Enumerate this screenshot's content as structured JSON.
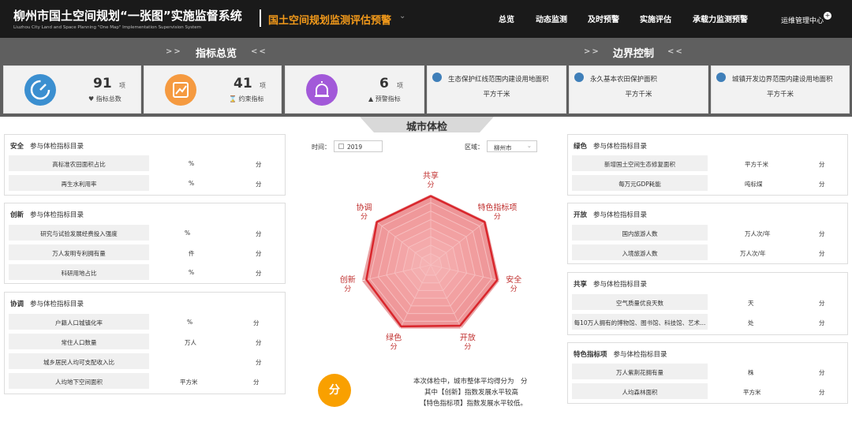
{
  "header": {
    "title": "柳州市国土空间规划“一张图”实施监督系统",
    "subtitle": "Liuzhou City Land and Space Planning \"One Map\" Implementation Supervision System",
    "module": "国土空间规划监测评估预警",
    "nav": [
      "总览",
      "动态监测",
      "及时预警",
      "实施评估",
      "承载力监测预警"
    ],
    "ops": "运维管理中心",
    "ops_badge": "+"
  },
  "band": {
    "left_title": "指标总览",
    "right_title": "边界控制",
    "chev_left": ">>",
    "chev_right": "<<"
  },
  "kpis": [
    {
      "value": "91",
      "unit": "项",
      "label": "指标总数",
      "label_icon": "heart-icon",
      "color": "#3b8fd0"
    },
    {
      "value": "41",
      "unit": "项",
      "label": "约束指标",
      "label_icon": "hourglass-icon",
      "color": "#f59a40"
    },
    {
      "value": "6",
      "unit": "项",
      "label": "预警指标",
      "label_icon": "warning-icon",
      "color": "#a259d9"
    }
  ],
  "boundaries": [
    {
      "title": "生态保护红线范围内建设用地面积",
      "unit": "平方千米",
      "icon": "gear-icon"
    },
    {
      "title": "永久基本农田保护面积",
      "unit": "平方千米",
      "icon": "gear-icon"
    },
    {
      "title": "城镇开发边界范围内建设用地面积",
      "unit": "平方千米",
      "icon": "gear-icon"
    }
  ],
  "center_tab": "城市体检",
  "controls": {
    "time_label": "时间：",
    "year": "2019",
    "region_label": "区域：",
    "region": "柳州市",
    "calendar_icon": "calendar-icon",
    "dropdown_icon": "chevron-down-icon"
  },
  "radar": {
    "axes": [
      {
        "label": "共享",
        "score": "分"
      },
      {
        "label": "特色指标项",
        "score": "分"
      },
      {
        "label": "安全",
        "score": "分"
      },
      {
        "label": "开放",
        "score": "分"
      },
      {
        "label": "绿色",
        "score": "分"
      },
      {
        "label": "创新",
        "score": "分"
      },
      {
        "label": "协调",
        "score": "分"
      }
    ],
    "values": [
      0.97,
      0.97,
      0.96,
      0.95,
      0.96,
      0.93,
      0.97
    ],
    "fill_color": "#f08b8d",
    "stroke_color": "#d9262c"
  },
  "score_badge": "分",
  "summary": [
    "本次体检中，城市整体平均得分为　分",
    "其中【创新】指数发展水平较高",
    "【特色指标项】指数发展水平较低。"
  ],
  "left_panels": [
    {
      "cat": "安全",
      "caption": "参与体检指标目录",
      "rows": [
        {
          "name": "高标准农田面积占比",
          "unit": "%",
          "score": "分"
        },
        {
          "name": "再生水利用率",
          "unit": "%",
          "score": "分"
        }
      ]
    },
    {
      "cat": "创新",
      "caption": "参与体检指标目录",
      "rows": [
        {
          "name": "研究与试验发展经费投入强度",
          "unit": "%",
          "score": "分"
        },
        {
          "name": "万人发明专利拥有量",
          "unit": "件",
          "score": "分"
        },
        {
          "name": "科研用地占比",
          "unit": "%",
          "score": "分"
        }
      ]
    },
    {
      "cat": "协调",
      "caption": "参与体检指标目录",
      "rows": [
        {
          "name": "户籍人口城镇化率",
          "unit": "%",
          "score": "分"
        },
        {
          "name": "常住人口数量",
          "unit": "万人",
          "score": "分"
        },
        {
          "name": "城乡居民人均可支配收入比",
          "unit": "",
          "score": "分"
        },
        {
          "name": "人均地下空间面积",
          "unit": "平方米",
          "score": "分"
        }
      ]
    }
  ],
  "right_panels": [
    {
      "cat": "绿色",
      "caption": "参与体检指标目录",
      "rows": [
        {
          "name": "新增国土空间生态修复面积",
          "unit": "平方千米",
          "score": "分"
        },
        {
          "name": "每万元GDP耗能",
          "unit": "吨标煤",
          "score": "分"
        }
      ]
    },
    {
      "cat": "开放",
      "caption": "参与体检指标目录",
      "rows": [
        {
          "name": "国内旅游人数",
          "unit": "万人次/年",
          "score": "分"
        },
        {
          "name": "入境旅游人数",
          "unit": "万人次/年",
          "score": "分"
        }
      ]
    },
    {
      "cat": "共享",
      "caption": "参与体检指标目录",
      "rows": [
        {
          "name": "空气质量优良天数",
          "unit": "天",
          "score": "分"
        },
        {
          "name": "每10万人拥有的博物馆、图书馆、科技馆、艺术...",
          "unit": "处",
          "score": "分"
        }
      ]
    },
    {
      "cat": "特色指标项",
      "caption": "参与体检指标目录",
      "rows": [
        {
          "name": "万人紫荆花拥有量",
          "unit": "株",
          "score": "分"
        },
        {
          "name": "人均森林面积",
          "unit": "平方米",
          "score": "分"
        }
      ]
    }
  ]
}
